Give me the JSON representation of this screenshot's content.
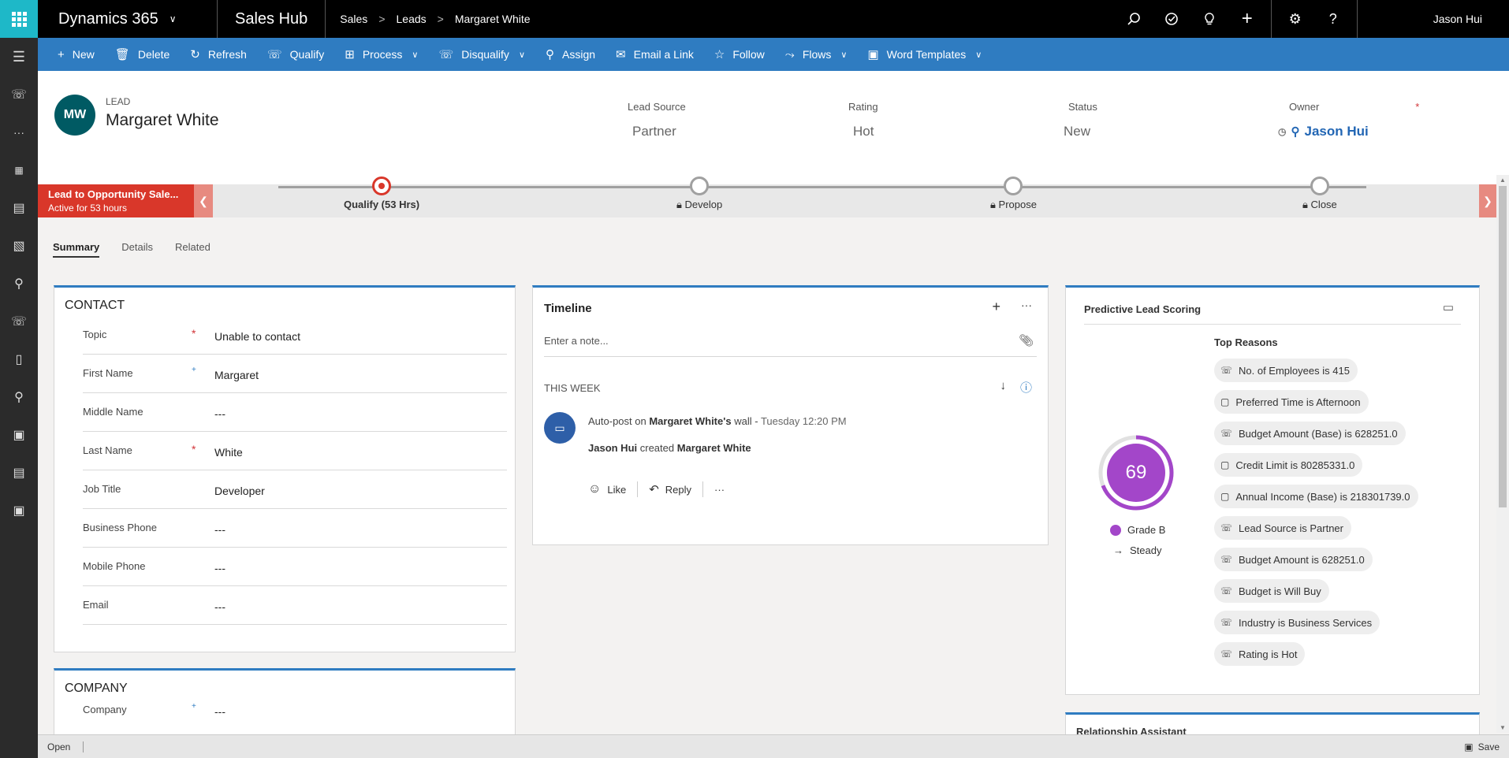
{
  "topbar": {
    "app_name": "Dynamics 365",
    "hub": "Sales Hub",
    "breadcrumb": [
      "Sales",
      "Leads",
      "Margaret White"
    ],
    "user": "Jason Hui"
  },
  "commands": [
    {
      "icon": "plus-icon",
      "glyph": "+",
      "label": "New",
      "menu": false
    },
    {
      "icon": "delete-icon",
      "glyph": "🗑",
      "label": "Delete",
      "menu": false
    },
    {
      "icon": "refresh-icon",
      "glyph": "↻",
      "label": "Refresh",
      "menu": false
    },
    {
      "icon": "qualify-icon",
      "glyph": "☏",
      "label": "Qualify",
      "menu": false
    },
    {
      "icon": "process-icon",
      "glyph": "⊞",
      "label": "Process",
      "menu": true
    },
    {
      "icon": "disqualify-icon",
      "glyph": "☏",
      "label": "Disqualify",
      "menu": true
    },
    {
      "icon": "assign-icon",
      "glyph": "⚲",
      "label": "Assign",
      "menu": false
    },
    {
      "icon": "email-link-icon",
      "glyph": "✉",
      "label": "Email a Link",
      "menu": false
    },
    {
      "icon": "star-icon",
      "glyph": "☆",
      "label": "Follow",
      "menu": false
    },
    {
      "icon": "flows-icon",
      "glyph": "⤳",
      "label": "Flows",
      "menu": true
    },
    {
      "icon": "word-icon",
      "glyph": "▣",
      "label": "Word Templates",
      "menu": true
    }
  ],
  "header": {
    "initials": "MW",
    "entity_type": "LEAD",
    "name": "Margaret White",
    "fields": [
      {
        "label": "Lead Source",
        "value": "Partner"
      },
      {
        "label": "Rating",
        "value": "Hot"
      },
      {
        "label": "Status",
        "value": "New"
      },
      {
        "label": "Owner",
        "value": "Jason Hui"
      }
    ]
  },
  "bpf": {
    "title": "Lead to Opportunity Sale...",
    "subtitle": "Active for 53 hours",
    "stages": [
      {
        "name": "Qualify  (53 Hrs)",
        "active": true
      },
      {
        "name": "Develop",
        "active": false
      },
      {
        "name": "Propose",
        "active": false
      },
      {
        "name": "Close",
        "active": false
      }
    ]
  },
  "tabs": [
    "Summary",
    "Details",
    "Related"
  ],
  "contact": {
    "title": "CONTACT",
    "fields": [
      {
        "label": "Topic",
        "value": "Unable to contact",
        "req": "*"
      },
      {
        "label": "First Name",
        "value": "Margaret",
        "req": "+"
      },
      {
        "label": "Middle Name",
        "value": "---",
        "req": ""
      },
      {
        "label": "Last Name",
        "value": "White",
        "req": "*"
      },
      {
        "label": "Job Title",
        "value": "Developer",
        "req": ""
      },
      {
        "label": "Business Phone",
        "value": "---",
        "req": ""
      },
      {
        "label": "Mobile Phone",
        "value": "---",
        "req": ""
      },
      {
        "label": "Email",
        "value": "---",
        "req": ""
      }
    ]
  },
  "company": {
    "title": "COMPANY",
    "fields": [
      {
        "label": "Company",
        "value": "---",
        "req": "+"
      }
    ]
  },
  "timeline": {
    "title": "Timeline",
    "note_placeholder": "Enter a note...",
    "week": "THIS WEEK",
    "post_prefix": "Auto-post on",
    "post_target": "Margaret White's",
    "post_wall": "wall -",
    "post_time": "Tuesday 12:20 PM",
    "actor": "Jason Hui",
    "verb": "created",
    "object": "Margaret White",
    "like": "Like",
    "reply": "Reply"
  },
  "scoring": {
    "title": "Predictive Lead Scoring",
    "score": "69",
    "score_value": 69,
    "grade": "Grade B",
    "trend": "Steady",
    "reasons_title": "Top Reasons",
    "reasons": [
      {
        "icon": "phone-icon",
        "glyph": "☏",
        "text": "No. of Employees is 415"
      },
      {
        "icon": "contact-card-icon",
        "glyph": "▢",
        "text": "Preferred Time is Afternoon"
      },
      {
        "icon": "phone-icon",
        "glyph": "☏",
        "text": "Budget Amount (Base) is 628251.0"
      },
      {
        "icon": "contact-card-icon",
        "glyph": "▢",
        "text": "Credit Limit is 80285331.0"
      },
      {
        "icon": "contact-card-icon",
        "glyph": "▢",
        "text": "Annual Income (Base) is 218301739.0"
      },
      {
        "icon": "phone-icon",
        "glyph": "☏",
        "text": "Lead Source is Partner"
      },
      {
        "icon": "phone-icon",
        "glyph": "☏",
        "text": "Budget Amount is 628251.0"
      },
      {
        "icon": "phone-icon",
        "glyph": "☏",
        "text": "Budget is Will Buy"
      },
      {
        "icon": "phone-icon",
        "glyph": "☏",
        "text": "Industry is Business Services"
      },
      {
        "icon": "phone-icon",
        "glyph": "☏",
        "text": "Rating is Hot"
      }
    ]
  },
  "relationship": {
    "title": "Relationship Assistant"
  },
  "status": {
    "state": "Open",
    "save": "Save"
  }
}
